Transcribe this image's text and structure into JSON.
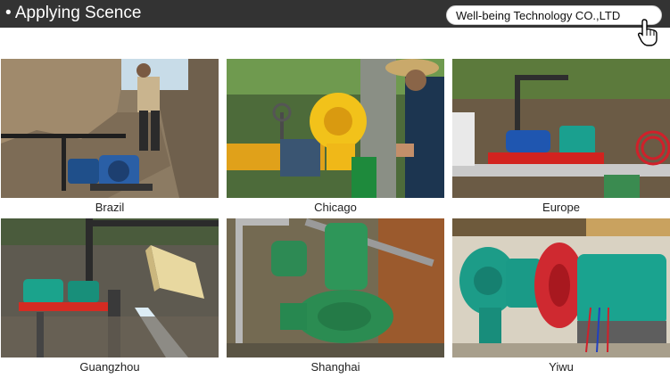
{
  "header": {
    "title": "• Applying Scence",
    "company": "Well-being Technology CO.,LTD"
  },
  "colors": {
    "header_bg": "#333333",
    "header_text": "#ffffff"
  },
  "gallery": [
    {
      "caption": "Brazil"
    },
    {
      "caption": "Chicago"
    },
    {
      "caption": "Europe"
    },
    {
      "caption": "Guangzhou"
    },
    {
      "caption": "Shanghai"
    },
    {
      "caption": "Yiwu"
    }
  ]
}
